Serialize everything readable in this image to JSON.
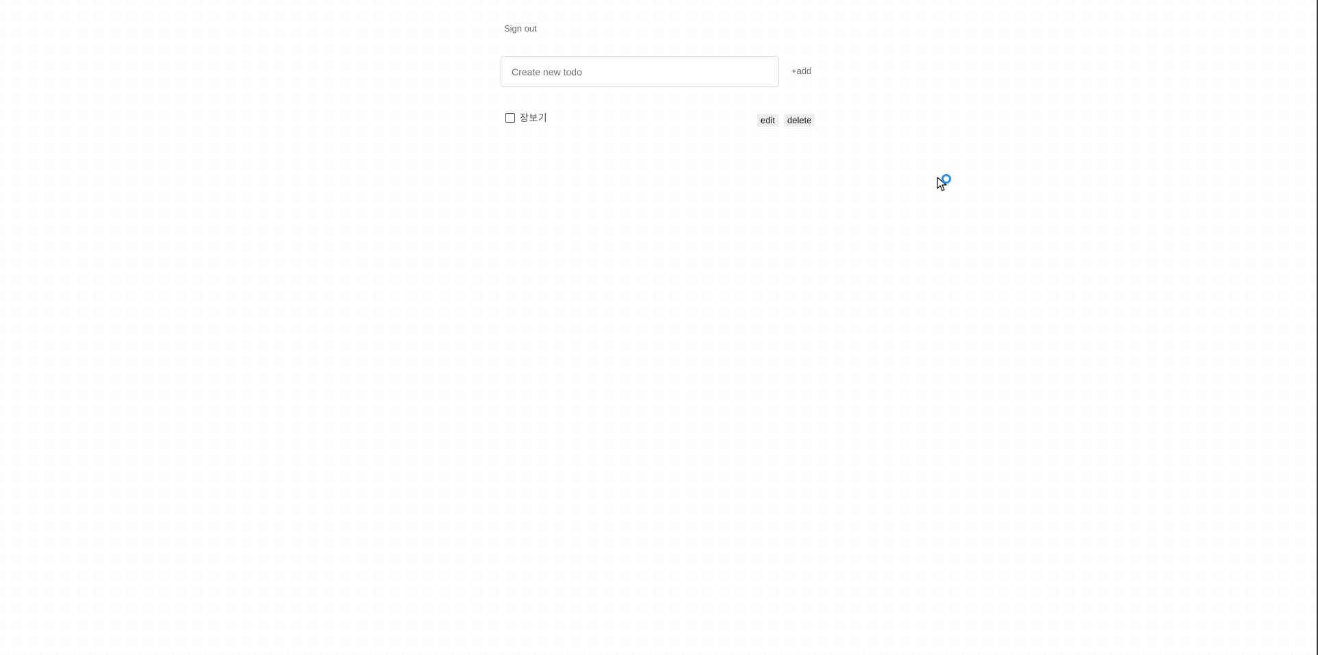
{
  "header": {
    "signout_label": "Sign out"
  },
  "new_todo": {
    "placeholder": "Create new todo",
    "value": "",
    "add_label": "+add"
  },
  "todos": [
    {
      "text": "장보기",
      "completed": false,
      "edit_label": "edit",
      "delete_label": "delete"
    }
  ],
  "colors": {
    "accent": "#2b8ee8",
    "muted_text": "#6b6b6b",
    "button_bg": "#efefef"
  },
  "icons": {
    "cursor": "arrow-pointer-icon",
    "busy": "loading-ring-icon"
  }
}
